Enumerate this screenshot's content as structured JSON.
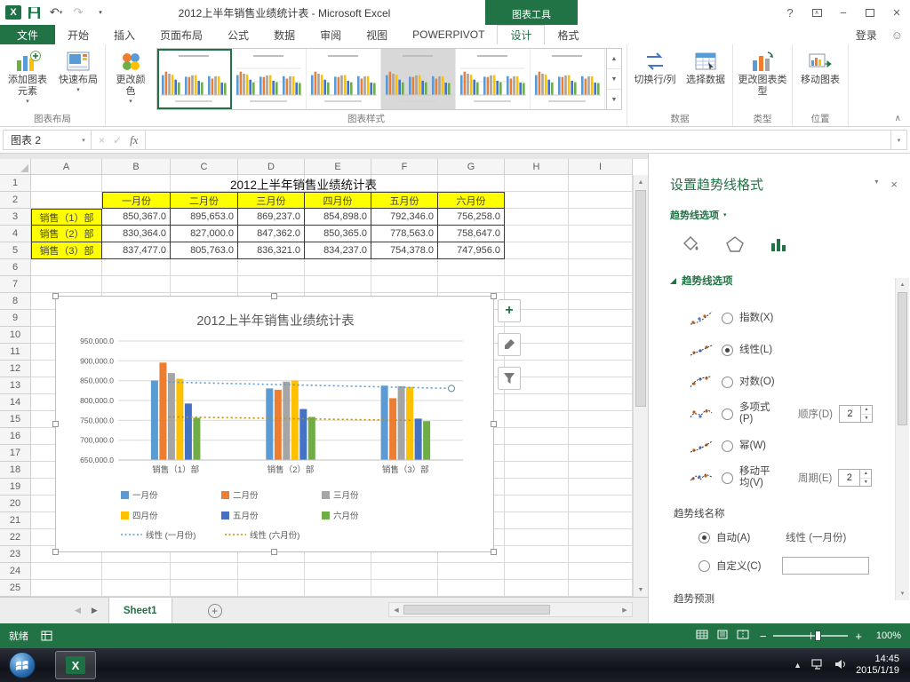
{
  "title_bar": {
    "title": "2012上半年销售业绩统计表 - Microsoft Excel",
    "contextual_group": "图表工具"
  },
  "ribbon": {
    "file_tab": "文件",
    "tabs": [
      "开始",
      "插入",
      "页面布局",
      "公式",
      "数据",
      "审阅",
      "视图",
      "POWERPIVOT",
      "设计",
      "格式"
    ],
    "active_tab": "设计",
    "sign_in": "登录",
    "buttons": {
      "add_chart_element": "添加图表元素",
      "quick_layout": "快速布局",
      "change_colors": "更改颜色",
      "switch_row_col": "切换行/列",
      "select_data": "选择数据",
      "change_chart_type": "更改图表类型",
      "move_chart": "移动图表"
    },
    "group_labels": {
      "chart_layout": "图表布局",
      "chart_styles": "图表样式",
      "data": "数据",
      "type": "类型",
      "location": "位置"
    }
  },
  "formula_bar": {
    "name_box": "图表 2",
    "fx": "fx"
  },
  "sheet": {
    "col_headers": [
      "A",
      "B",
      "C",
      "D",
      "E",
      "F",
      "G",
      "H",
      "I"
    ],
    "row_count": 25,
    "table": {
      "title": "2012上半年销售业绩统计表",
      "month_headers": [
        "一月份",
        "二月份",
        "三月份",
        "四月份",
        "五月份",
        "六月份"
      ],
      "rows": [
        {
          "label": "销售（1）部",
          "values": [
            "850,367.0",
            "895,653.0",
            "869,237.0",
            "854,898.0",
            "792,346.0",
            "756,258.0"
          ]
        },
        {
          "label": "销售（2）部",
          "values": [
            "830,364.0",
            "827,000.0",
            "847,362.0",
            "850,365.0",
            "778,563.0",
            "758,647.0"
          ]
        },
        {
          "label": "销售（3）部",
          "values": [
            "837,477.0",
            "805,763.0",
            "836,321.0",
            "834,237.0",
            "754,378.0",
            "747,956.0"
          ]
        }
      ]
    },
    "tab_name": "Sheet1"
  },
  "chart_data": {
    "type": "bar",
    "title": "2012上半年销售业绩统计表",
    "categories": [
      "销售（1）部",
      "销售（2）部",
      "销售（3）部"
    ],
    "series": [
      {
        "name": "一月份",
        "color": "#5B9BD5",
        "values": [
          850367,
          830364,
          837477
        ]
      },
      {
        "name": "二月份",
        "color": "#ED7D31",
        "values": [
          895653,
          827000,
          805763
        ]
      },
      {
        "name": "三月份",
        "color": "#A5A5A5",
        "values": [
          869237,
          847362,
          836321
        ]
      },
      {
        "name": "四月份",
        "color": "#FFC000",
        "values": [
          854898,
          850365,
          834237
        ]
      },
      {
        "name": "五月份",
        "color": "#4472C4",
        "values": [
          792346,
          778563,
          754378
        ]
      },
      {
        "name": "六月份",
        "color": "#70AD47",
        "values": [
          756258,
          758647,
          747956
        ]
      }
    ],
    "trendlines": [
      {
        "name": "线性 (一月份)",
        "series": "一月份",
        "color": "#5B9BD5",
        "style": "dotted",
        "selected": true
      },
      {
        "name": "线性 (六月份)",
        "series": "六月份",
        "color": "#BF9000",
        "style": "dotted",
        "selected": false
      }
    ],
    "ylim": [
      650000,
      950000
    ],
    "ytick_step": 50000,
    "ytick_labels": [
      "950,000.0",
      "900,000.0",
      "850,000.0",
      "800,000.0",
      "750,000.0",
      "700,000.0",
      "650,000.0"
    ],
    "legend_position": "bottom",
    "grid": true
  },
  "task_pane": {
    "title": "设置趋势线格式",
    "dropdown_label": "趋势线选项",
    "section_header": "趋势线选项",
    "options": [
      {
        "label": "指数(X)",
        "checked": false
      },
      {
        "label": "线性(L)",
        "checked": true
      },
      {
        "label": "对数(O)",
        "checked": false
      },
      {
        "label": "多项式(P)",
        "checked": false,
        "extra_label": "顺序(D)",
        "extra_value": "2"
      },
      {
        "label": "幂(W)",
        "checked": false
      },
      {
        "label": "移动平均(V)",
        "checked": false,
        "extra_label": "周期(E)",
        "extra_value": "2"
      }
    ],
    "name_section": {
      "title": "趋势线名称",
      "auto_label": "自动(A)",
      "auto_value": "线性 (一月份)",
      "custom_label": "自定义(C)"
    },
    "forecast_section": "趋势预测"
  },
  "status_bar": {
    "ready": "就绪",
    "zoom": "100%"
  },
  "taskbar": {
    "time": "14:45",
    "date": "2015/1/19"
  }
}
